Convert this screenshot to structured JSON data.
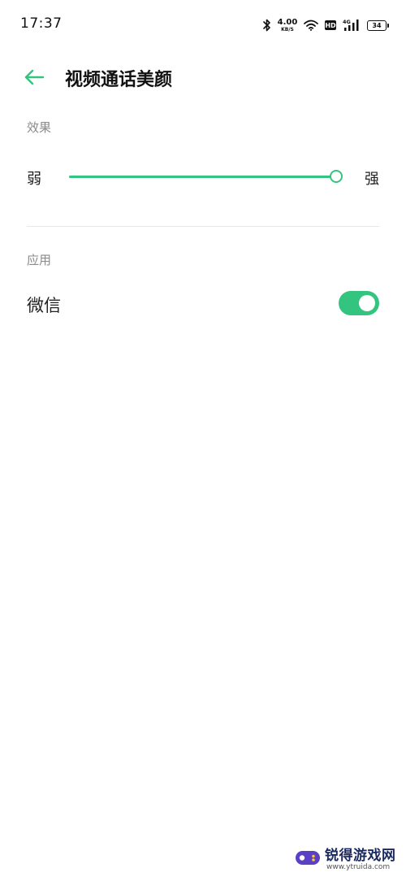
{
  "status_bar": {
    "time": "17:37",
    "net_speed_value": "4.00",
    "net_speed_unit": "KB/S",
    "hd_label": "HD",
    "network_label": "4G",
    "battery_level": "34",
    "icons": [
      "bluetooth-icon",
      "wifi-icon",
      "hd-icon",
      "cellular-signal-icon",
      "battery-icon"
    ]
  },
  "header": {
    "back_icon": "arrow-left-icon",
    "title": "视频通话美颜"
  },
  "effect_section": {
    "label": "效果",
    "slider": {
      "min_label": "弱",
      "max_label": "强",
      "value": 1.0
    }
  },
  "apps_section": {
    "label": "应用",
    "items": [
      {
        "name": "微信",
        "enabled": true
      }
    ]
  },
  "watermark": {
    "text": "锐得游戏网",
    "url": "www.ytruida.com"
  },
  "colors": {
    "accent": "#33c580",
    "text_primary": "#222222",
    "text_secondary": "#8a8a8a",
    "divider": "#e8e8e8",
    "background": "#ffffff"
  }
}
